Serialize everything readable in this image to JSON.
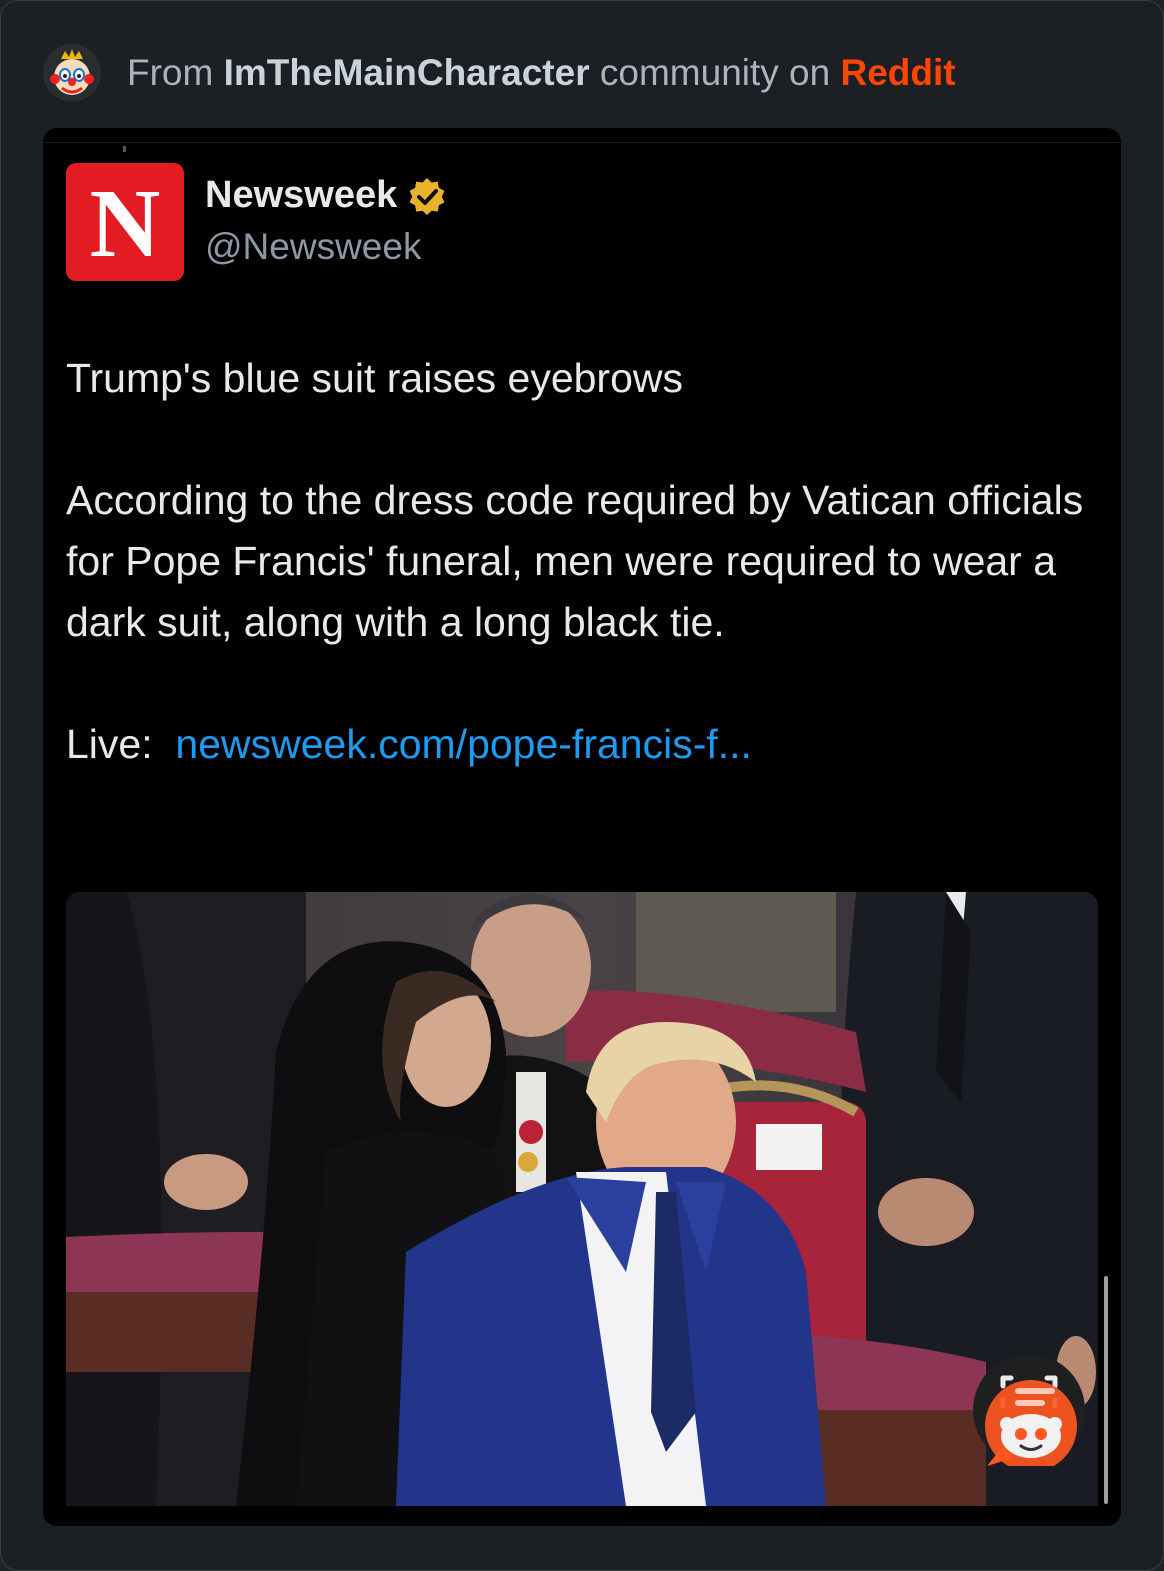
{
  "header": {
    "prefix": "From",
    "community": "ImTheMainCharacter",
    "middle": "community on",
    "platform": "Reddit",
    "avatar_icon": "clown-king-icon"
  },
  "post": {
    "author_name": "Newsweek",
    "author_handle": "@Newsweek",
    "logo_letter": "N",
    "verified_icon": "gold-verified-badge-icon",
    "headline": "Trump's blue suit raises eyebrows",
    "body": "According to the dress code required by Vatican officials for Pope Francis' funeral, men were required to wear a dark suit, along with a long black tie.",
    "live_label": "Live:",
    "link_text": "newsweek.com/pope-francis-f..."
  },
  "overlay": {
    "snoo_icon": "reddit-answers-snoo-icon"
  },
  "colors": {
    "reddit_orange": "#ff4500",
    "link_blue": "#1d9bf0",
    "newsweek_red": "#e31b23",
    "verified_gold": "#e8b22b"
  }
}
